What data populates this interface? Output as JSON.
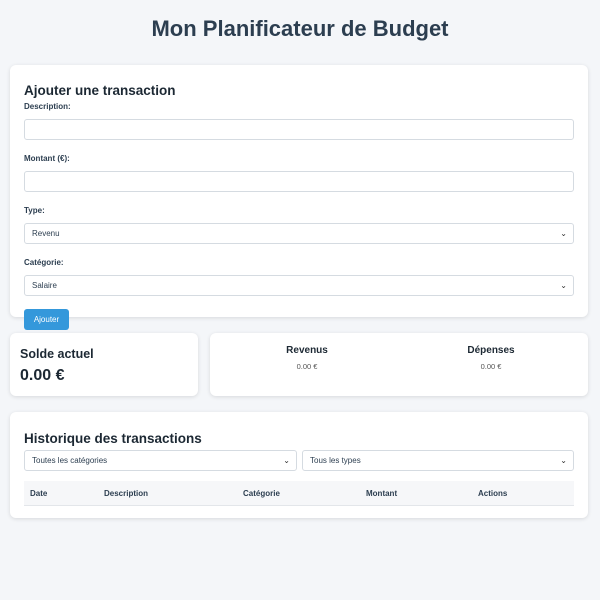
{
  "title": "Mon Planificateur de Budget",
  "form": {
    "heading": "Ajouter une transaction",
    "description_label": "Description:",
    "description_value": "",
    "amount_label": "Montant (€):",
    "amount_value": "",
    "type_label": "Type:",
    "type_value": "Revenu",
    "category_label": "Catégorie:",
    "category_value": "Salaire",
    "add_button": "Ajouter"
  },
  "balance": {
    "label": "Solde actuel",
    "value": "0.00 €"
  },
  "summary": {
    "income_label": "Revenus",
    "income_value": "0.00 €",
    "expenses_label": "Dépenses",
    "expenses_value": "0.00 €"
  },
  "history": {
    "heading": "Historique des transactions",
    "category_filter": "Toutes les catégories",
    "type_filter": "Tous les types",
    "columns": [
      "Date",
      "Description",
      "Catégorie",
      "Montant",
      "Actions"
    ]
  },
  "colors": {
    "accent": "#3498db",
    "text": "#2c3e50",
    "background": "#f4f6f9"
  },
  "icons": {
    "select_chevron": "chevron-down-icon"
  }
}
